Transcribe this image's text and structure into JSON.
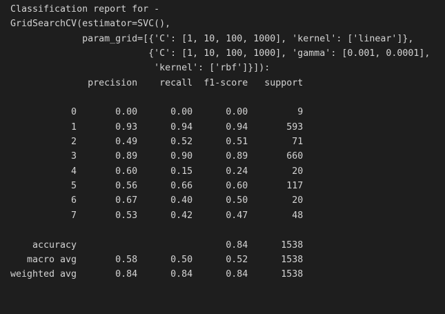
{
  "report": {
    "header_lines": [
      "Classification report for -",
      "GridSearchCV(estimator=SVC(),",
      "             param_grid=[{'C': [1, 10, 100, 1000], 'kernel': ['linear']},",
      "                         {'C': [1, 10, 100, 1000], 'gamma': [0.001, 0.0001],",
      "                          'kernel': ['rbf']}]):"
    ],
    "column_header": "              precision    recall  f1-score   support",
    "blank_1": "",
    "rows": [
      "           0       0.00      0.00      0.00         9",
      "           1       0.93      0.94      0.94       593",
      "           2       0.49      0.52      0.51        71",
      "           3       0.89      0.90      0.89       660",
      "           4       0.60      0.15      0.24        20",
      "           5       0.56      0.66      0.60       117",
      "           6       0.67      0.40      0.50        20",
      "           7       0.53      0.42      0.47        48"
    ],
    "blank_2": "",
    "summary": [
      "    accuracy                           0.84      1538",
      "   macro avg       0.58      0.50      0.52      1538",
      "weighted avg       0.84      0.84      0.84      1538"
    ]
  },
  "colors": {
    "background": "#1e1e1e",
    "text": "#d4d4d4"
  }
}
